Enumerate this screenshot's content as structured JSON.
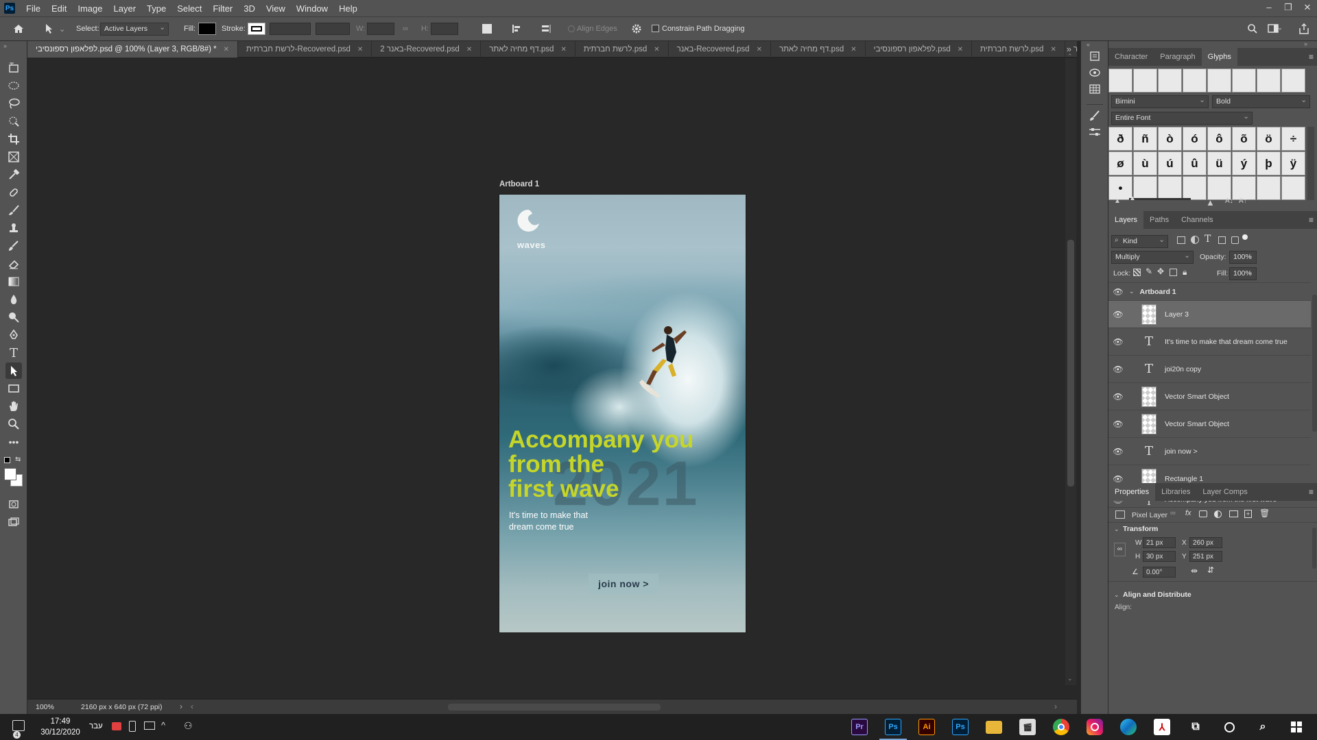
{
  "app": {
    "logo": "Ps",
    "accent": "#31a8ff"
  },
  "menu": [
    "File",
    "Edit",
    "Image",
    "Layer",
    "Type",
    "Select",
    "Filter",
    "3D",
    "View",
    "Window",
    "Help"
  ],
  "options": {
    "select_label": "Select:",
    "select_value": "Active Layers",
    "fill_label": "Fill:",
    "stroke_label": "Stroke:",
    "w_label": "W:",
    "h_label": "H:",
    "align_edges": "Align Edges",
    "constrain": "Constrain Path Dragging"
  },
  "tabs": [
    {
      "label": "לפלאפון רספונסיבי.psd @ 100% (Layer 3, RGB/8#) *",
      "active": true
    },
    {
      "label": "לרשת חברתית-Recovered.psd"
    },
    {
      "label": "באנר 2-Recovered.psd"
    },
    {
      "label": "דף מחיה לאתר.psd"
    },
    {
      "label": "לרשת חברתית.psd"
    },
    {
      "label": "באנר-Recovered.psd"
    },
    {
      "label": "דף מחיה לאתר.psd"
    },
    {
      "label": "לפלאפון רספונסיבי.psd"
    },
    {
      "label": "לרשת חברתית.psd"
    },
    {
      "label": "ר"
    }
  ],
  "artboard": {
    "label": "Artboard 1",
    "logo_text": "waves",
    "headline": [
      "Accompany you",
      "from the",
      "first wave"
    ],
    "watermark": "2021",
    "subtext": [
      "It's time to make that",
      "dream come true"
    ],
    "cta": "join now >",
    "headline_color": "#c6d629",
    "cta_color": "#2a3a4a"
  },
  "status": {
    "zoom": "100%",
    "doc_size": "2160 px x 640 px (72 ppi)"
  },
  "glyphs_panel": {
    "tabs": [
      "Character",
      "Paragraph",
      "Glyphs"
    ],
    "active_tab": "Glyphs",
    "font": "Bimini",
    "style": "Bold",
    "scope": "Entire Font",
    "row1": [
      "ð",
      "ñ",
      "ò",
      "ó",
      "ô",
      "õ",
      "ö",
      "÷"
    ],
    "row2": [
      "ø",
      "ù",
      "ú",
      "û",
      "ü",
      "ý",
      "þ",
      "ÿ"
    ],
    "row3": [
      "•"
    ]
  },
  "layers_panel": {
    "tabs": [
      "Layers",
      "Paths",
      "Channels"
    ],
    "active_tab": "Layers",
    "filter": "Kind",
    "blend_mode": "Multiply",
    "opacity_label": "Opacity:",
    "opacity": "100%",
    "lock_label": "Lock:",
    "fill_label": "Fill:",
    "fill": "100%",
    "group": "Artboard 1",
    "layers": [
      {
        "name": "Layer 3",
        "kind": "pixel",
        "selected": true
      },
      {
        "name": "It's time to make that  dream come true",
        "kind": "text"
      },
      {
        "name": "joi20n copy",
        "kind": "text"
      },
      {
        "name": "Vector Smart Object",
        "kind": "smart"
      },
      {
        "name": "Vector Smart Object",
        "kind": "smart"
      },
      {
        "name": "join now >",
        "kind": "text"
      },
      {
        "name": "Rectangle 1",
        "kind": "smart"
      },
      {
        "name": "Accompany you from the  first wave",
        "kind": "text"
      }
    ]
  },
  "properties_panel": {
    "tabs": [
      "Properties",
      "Libraries",
      "Layer Comps"
    ],
    "active_tab": "Properties",
    "layer_type": "Pixel Layer",
    "transform_label": "Transform",
    "w_label": "W",
    "w": "21 px",
    "h_label": "H",
    "h": "30 px",
    "x_label": "X",
    "x": "260 px",
    "y_label": "Y",
    "y": "251 px",
    "angle": "0.00°",
    "align_label": "Align and Distribute",
    "align_sub": "Align:"
  },
  "taskbar": {
    "time": "17:49",
    "date": "30/12/2020",
    "lang": "עבר",
    "notif_count": "4",
    "apps": [
      {
        "label": "Pr",
        "bg": "#2a0a3e",
        "fg": "#9999ff"
      },
      {
        "label": "Ps",
        "bg": "#001e36",
        "fg": "#31a8ff"
      },
      {
        "label": "Ai",
        "bg": "#330000",
        "fg": "#ff9a00"
      },
      {
        "label": "Ps",
        "bg": "#001e36",
        "fg": "#31a8ff"
      }
    ]
  }
}
